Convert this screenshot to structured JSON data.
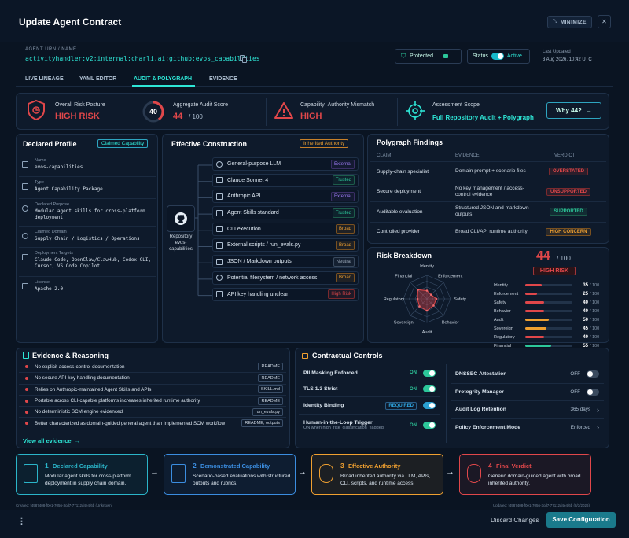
{
  "window": {
    "title": "Update Agent Contract",
    "minimize_label": "MINIMIZE",
    "close_glyph": "✕"
  },
  "urn": {
    "label": "AGENT URN / NAME",
    "value": "activityhandler:v2:internal:charli.ai:github:evos_capabilities"
  },
  "protected_label": "Protected",
  "status": {
    "label": "Status",
    "value": "Active"
  },
  "last_updated": {
    "label": "Last Updated",
    "value": "3 Aug 2026, 10:42 UTC"
  },
  "tabs": [
    "LIVE LINEAGE",
    "YAML EDITOR",
    "AUDIT & POLYGRAPH",
    "EVIDENCE"
  ],
  "active_tab": 2,
  "summary": {
    "risk_label": "Overall Risk Posture",
    "risk_value": "HIGH RISK",
    "score_label": "Aggregate Audit Score",
    "score_ring": "40",
    "score_value": "44",
    "score_max": "/ 100",
    "mismatch_label": "Capability–Authority Mismatch",
    "mismatch_value": "HIGH",
    "scope_label": "Assessment Scope",
    "scope_value": "Full Repository Audit + Polygraph",
    "why_button": "Why 44?"
  },
  "declared": {
    "title": "Declared Profile",
    "badge": "Claimed Capability",
    "fields": [
      {
        "icon": "user-icon",
        "label": "Name",
        "value": "evos-capabilities"
      },
      {
        "icon": "cube-icon",
        "label": "Type",
        "value": "Agent Capability Package"
      },
      {
        "icon": "target-icon",
        "label": "Declared Purpose",
        "value": "Modular agent skills for cross-platform deployment"
      },
      {
        "icon": "globe-icon",
        "label": "Claimed Domain",
        "value": "Supply Chain / Logistics / Operations"
      },
      {
        "icon": "monitor-icon",
        "label": "Deployment Targets",
        "value": "Claude Code, OpenClaw/ClawHub, Codex CLI, Cursor, VS Code Copilot"
      },
      {
        "icon": "document-icon",
        "label": "License",
        "value": "Apache 2.0"
      }
    ]
  },
  "construction": {
    "title": "Effective Construction",
    "badge": "Inherited Authority",
    "repo_label": "Repository evos-capabilities",
    "items": [
      {
        "icon": "gear-icon",
        "label": "General-purpose LLM",
        "tag": "External",
        "tone": "purple"
      },
      {
        "icon": "cube-icon",
        "label": "Claude Sonnet 4",
        "tag": "Trusted",
        "tone": "green"
      },
      {
        "icon": "ai-icon",
        "label": "Anthropic API",
        "tag": "External",
        "tone": "purple"
      },
      {
        "icon": "book-icon",
        "label": "Agent Skills standard",
        "tag": "Trusted",
        "tone": "green"
      },
      {
        "icon": "terminal-icon",
        "label": "CLI execution",
        "tag": "Broad",
        "tone": "orange"
      },
      {
        "icon": "script-icon",
        "label": "External scripts / run_evals.py",
        "tag": "Broad",
        "tone": "orange"
      },
      {
        "icon": "file-icon",
        "label": "JSON / Markdown outputs",
        "tag": "Neutral",
        "tone": "gray"
      },
      {
        "icon": "globe-icon",
        "label": "Potential filesystem / network access",
        "tag": "Broad",
        "tone": "orange"
      },
      {
        "icon": "key-icon",
        "label": "API key handling unclear",
        "tag": "High Risk",
        "tone": "red"
      }
    ]
  },
  "polygraph": {
    "title": "Polygraph Findings",
    "headers": [
      "CLAIM",
      "EVIDENCE",
      "VERDICT"
    ],
    "rows": [
      {
        "claim": "Supply-chain specialist",
        "evidence": "Domain prompt + scenario files",
        "verdict": "OVERSTATED",
        "tone": "red"
      },
      {
        "claim": "Secure deployment",
        "evidence": "No key management / access-control evidence",
        "verdict": "UNSUPPORTED",
        "tone": "red"
      },
      {
        "claim": "Auditable evaluation",
        "evidence": "Structured JSON and markdown outputs",
        "verdict": "SUPPORTED",
        "tone": "green"
      },
      {
        "claim": "Controlled provider",
        "evidence": "Broad CLI/API runtime authority",
        "verdict": "HIGH CONCERN",
        "tone": "orange"
      }
    ]
  },
  "risk": {
    "title": "Risk Breakdown",
    "score": "44",
    "max": "/ 100",
    "badge": "HIGH RISK",
    "axes": [
      "Identity",
      "Enforcement",
      "Safety",
      "Behavior",
      "Audit",
      "Sovereign",
      "Regulatory",
      "Financial"
    ],
    "bars": [
      {
        "label": "Identity",
        "value": 35,
        "max": "/ 100",
        "color": "#e0474a"
      },
      {
        "label": "Enforcement",
        "value": 25,
        "max": "/ 100",
        "color": "#e0474a"
      },
      {
        "label": "Safety",
        "value": 40,
        "max": "/ 100",
        "color": "#e0474a"
      },
      {
        "label": "Behavior",
        "value": 40,
        "max": "/ 100",
        "color": "#e0474a"
      },
      {
        "label": "Audit",
        "value": 50,
        "max": "/ 100",
        "color": "#f0a030"
      },
      {
        "label": "Sovereign",
        "value": 45,
        "max": "/ 100",
        "color": "#f0a030"
      },
      {
        "label": "Regulatory",
        "value": 40,
        "max": "/ 100",
        "color": "#e0474a"
      },
      {
        "label": "Financial",
        "value": 55,
        "max": "/ 100",
        "color": "#2cc79a"
      }
    ]
  },
  "evidence": {
    "title": "Evidence & Reasoning",
    "view_all": "View all evidence",
    "items": [
      {
        "text": "No explicit access-control documentation",
        "tag": "README"
      },
      {
        "text": "No secure API-key handling documentation",
        "tag": "README"
      },
      {
        "text": "Relies on Anthropic-maintained Agent Skills and APIs",
        "tag": "SKILL.md"
      },
      {
        "text": "Portable across CLI-capable platforms increases inherited runtime authority",
        "tag": "README"
      },
      {
        "text": "No deterministic SCM engine evidenced",
        "tag": "run_evals.py"
      },
      {
        "text": "Better characterized as domain-guided general agent than implemented SCM workflow",
        "tag": "README, outputs"
      }
    ]
  },
  "controls": {
    "title": "Contractual Controls",
    "left": [
      {
        "label": "PII Masking Enforced",
        "state": "ON",
        "on": true
      },
      {
        "label": "TLS 1.3 Strict",
        "state": "ON",
        "on": true
      },
      {
        "label": "Identity Binding",
        "state": "REQUIRED",
        "on": true
      },
      {
        "label": "Human-in-the-Loop Trigger",
        "sub": "ON when high_risk_classification_flagged",
        "state": "ON",
        "on": true
      }
    ],
    "right": [
      {
        "label": "DNSSEC Attestation",
        "state": "OFF",
        "kind": "toggle"
      },
      {
        "label": "Protegrity Manager",
        "state": "OFF",
        "kind": "toggle"
      },
      {
        "label": "Audit Log Retention",
        "state": "365 days",
        "kind": "chevron"
      },
      {
        "label": "Policy Enforcement Mode",
        "state": "Enforced",
        "kind": "chevron"
      }
    ]
  },
  "flow": [
    {
      "num": "1",
      "title": "Declared Capability",
      "text": "Modular agent skills for cross-platform deployment in supply chain domain.",
      "color": "#2bb5c9"
    },
    {
      "num": "2",
      "title": "Demonstrated Capability",
      "text": "Scenario-based evaluations with structured outputs and rubrics.",
      "color": "#3b8de0"
    },
    {
      "num": "3",
      "title": "Effective Authority",
      "text": "Broad inherited authority via LLM, APIs, CLI, scripts, and runtime access.",
      "color": "#f0a030"
    },
    {
      "num": "4",
      "title": "Final Verdict",
      "text": "Generic domain-guided agent with broad inherited authority.",
      "color": "#e0474a"
    }
  ],
  "footer": {
    "created": "Created: f4987408-f0e1-7056-3cd7-77112d4e4f6b (Unknown)",
    "updated": "Updated: f4987408-f0e1-7056-3cd7-77112d4e4f6b (8/3/2026)",
    "discard": "Discard Changes",
    "save": "Save Configuration"
  },
  "colors": {
    "accent": "#2ee6d6",
    "danger": "#e0474a",
    "warn": "#f0a030",
    "ok": "#2cc79a"
  }
}
